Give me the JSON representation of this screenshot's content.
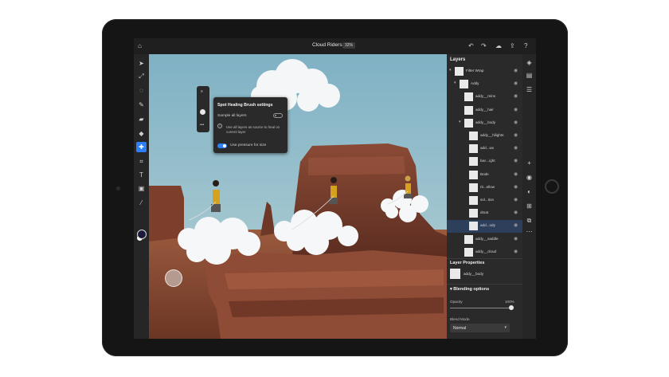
{
  "app": {
    "doc_title": "Cloud Riders",
    "zoom": "32%"
  },
  "topbar": {
    "icons": [
      "home-icon",
      "undo-icon",
      "redo-icon",
      "cloud-icon",
      "share-icon",
      "help-icon"
    ]
  },
  "toolbar": {
    "tools": [
      "select-icon",
      "transform-icon",
      "lasso-icon",
      "brush-icon",
      "eraser-icon",
      "fill-icon",
      "healing-brush-icon",
      "crop-icon",
      "type-icon",
      "image-icon",
      "eyedropper-icon"
    ],
    "active_tool": "healing-brush-icon",
    "foreground_color": "#1a1a3a",
    "background_color": "#ffffff"
  },
  "brush_popup": {
    "title": "Spot Healing Brush settings",
    "sample_all_label": "Sample all layers",
    "sample_all_on": false,
    "description": "Use all layers as source to heal on current layer",
    "pressure_label": "Use pressure for size",
    "pressure_on": true
  },
  "layers_panel": {
    "title": "Layers",
    "items": [
      {
        "name": "Filter Wrap",
        "indent": 0,
        "group": true
      },
      {
        "name": "Addy",
        "indent": 1,
        "group": true
      },
      {
        "name": "addy__reins",
        "indent": 2
      },
      {
        "name": "addy__hair",
        "indent": 2
      },
      {
        "name": "addy__body",
        "indent": 2,
        "group": true
      },
      {
        "name": "addy__hilights",
        "indent": 3
      },
      {
        "name": "add...wx",
        "indent": 3
      },
      {
        "name": "bac...ight",
        "indent": 3
      },
      {
        "name": "Bode",
        "indent": 3
      },
      {
        "name": "rit...ellow",
        "indent": 3
      },
      {
        "name": "sol...tion",
        "indent": 3
      },
      {
        "name": "dmat",
        "indent": 3
      },
      {
        "name": "add...ody",
        "indent": 3,
        "selected": true
      },
      {
        "name": "addy__saddle",
        "indent": 2
      },
      {
        "name": "addy__cloud",
        "indent": 2
      }
    ]
  },
  "layer_properties": {
    "title": "Layer Properties",
    "layer_name": "addy__body",
    "blending_title": "Blending options",
    "opacity_label": "Opacity",
    "opacity_value": "100%",
    "opacity_fraction": 1.0,
    "blend_mode_label": "Blend Mode",
    "blend_mode_value": "Normal"
  },
  "colors": {
    "accent": "#2d7ff9",
    "panel_bg": "#2a2a2a",
    "selected_row": "#2e3f5c"
  }
}
